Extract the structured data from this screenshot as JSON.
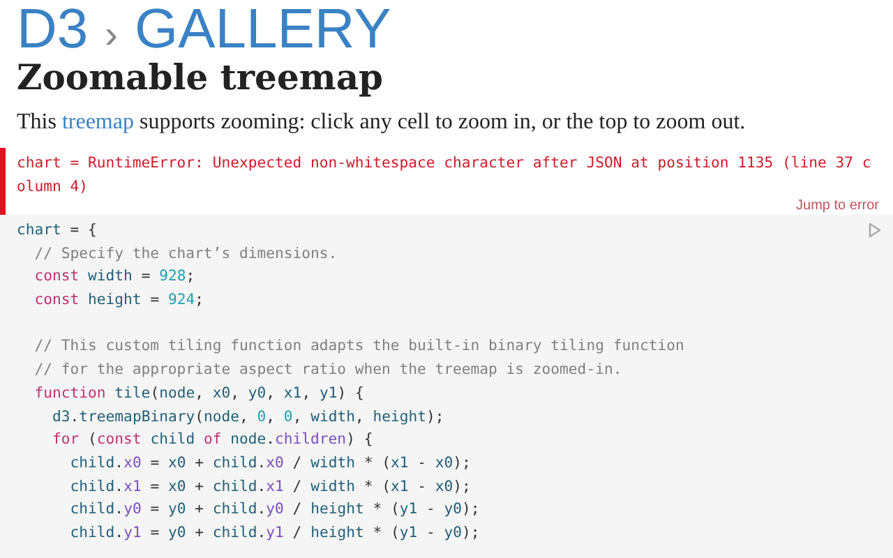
{
  "header": {
    "brand": "D3",
    "separator": "›",
    "section": "GALLERY"
  },
  "title": "Zoomable treemap",
  "intro": {
    "before": "This ",
    "link": "treemap",
    "after": " supports zooming: click any cell to zoom in, or the top to zoom out."
  },
  "error": {
    "message": "chart = RuntimeError: Unexpected non-whitespace character after JSON at position 1135 (line 37 column 4)",
    "button": "Jump to error"
  },
  "code": [
    {
      "kind": "code",
      "tokens": [
        {
          "kind": "v",
          "text": "chart "
        },
        {
          "kind": "p",
          "text": "= {"
        }
      ]
    },
    {
      "kind": "code",
      "tokens": [
        {
          "kind": "c",
          "text": "  // Specify the chart’s dimensions."
        }
      ]
    },
    {
      "kind": "code",
      "tokens": [
        {
          "kind": "k",
          "text": "  const "
        },
        {
          "kind": "v",
          "text": "width "
        },
        {
          "kind": "p",
          "text": "= "
        },
        {
          "kind": "n",
          "text": "928"
        },
        {
          "kind": "p",
          "text": ";"
        }
      ]
    },
    {
      "kind": "code",
      "tokens": [
        {
          "kind": "k",
          "text": "  const "
        },
        {
          "kind": "v",
          "text": "height "
        },
        {
          "kind": "p",
          "text": "= "
        },
        {
          "kind": "n",
          "text": "924"
        },
        {
          "kind": "p",
          "text": ";"
        }
      ]
    },
    {
      "kind": "blank"
    },
    {
      "kind": "code",
      "tokens": [
        {
          "kind": "c",
          "text": "  // This custom tiling function adapts the built-in binary tiling function"
        }
      ]
    },
    {
      "kind": "code",
      "tokens": [
        {
          "kind": "c",
          "text": "  // for the appropriate aspect ratio when the treemap is zoomed-in."
        }
      ]
    },
    {
      "kind": "code",
      "tokens": [
        {
          "kind": "k",
          "text": "  function "
        },
        {
          "kind": "v",
          "text": "tile"
        },
        {
          "kind": "p",
          "text": "("
        },
        {
          "kind": "v",
          "text": "node"
        },
        {
          "kind": "p",
          "text": ", "
        },
        {
          "kind": "v",
          "text": "x0"
        },
        {
          "kind": "p",
          "text": ", "
        },
        {
          "kind": "v",
          "text": "y0"
        },
        {
          "kind": "p",
          "text": ", "
        },
        {
          "kind": "v",
          "text": "x1"
        },
        {
          "kind": "p",
          "text": ", "
        },
        {
          "kind": "v",
          "text": "y1"
        },
        {
          "kind": "p",
          "text": ") {"
        }
      ]
    },
    {
      "kind": "code",
      "tokens": [
        {
          "kind": "v",
          "text": "    d3"
        },
        {
          "kind": "p",
          "text": "."
        },
        {
          "kind": "v",
          "text": "treemapBinary"
        },
        {
          "kind": "p",
          "text": "("
        },
        {
          "kind": "v",
          "text": "node"
        },
        {
          "kind": "p",
          "text": ", "
        },
        {
          "kind": "n",
          "text": "0"
        },
        {
          "kind": "p",
          "text": ", "
        },
        {
          "kind": "n",
          "text": "0"
        },
        {
          "kind": "p",
          "text": ", "
        },
        {
          "kind": "v",
          "text": "width"
        },
        {
          "kind": "p",
          "text": ", "
        },
        {
          "kind": "v",
          "text": "height"
        },
        {
          "kind": "p",
          "text": ");"
        }
      ]
    },
    {
      "kind": "code",
      "tokens": [
        {
          "kind": "k",
          "text": "    for "
        },
        {
          "kind": "p",
          "text": "("
        },
        {
          "kind": "k",
          "text": "const "
        },
        {
          "kind": "v",
          "text": "child "
        },
        {
          "kind": "k",
          "text": "of "
        },
        {
          "kind": "v",
          "text": "node"
        },
        {
          "kind": "p",
          "text": "."
        },
        {
          "kind": "m",
          "text": "children"
        },
        {
          "kind": "p",
          "text": ") {"
        }
      ]
    },
    {
      "kind": "code",
      "tokens": [
        {
          "kind": "v",
          "text": "      child"
        },
        {
          "kind": "p",
          "text": "."
        },
        {
          "kind": "m",
          "text": "x0 "
        },
        {
          "kind": "p",
          "text": "= "
        },
        {
          "kind": "v",
          "text": "x0 "
        },
        {
          "kind": "p",
          "text": "+ "
        },
        {
          "kind": "v",
          "text": "child"
        },
        {
          "kind": "p",
          "text": "."
        },
        {
          "kind": "m",
          "text": "x0 "
        },
        {
          "kind": "p",
          "text": "/ "
        },
        {
          "kind": "v",
          "text": "width "
        },
        {
          "kind": "p",
          "text": "* ("
        },
        {
          "kind": "v",
          "text": "x1 "
        },
        {
          "kind": "p",
          "text": "- "
        },
        {
          "kind": "v",
          "text": "x0"
        },
        {
          "kind": "p",
          "text": ");"
        }
      ]
    },
    {
      "kind": "code",
      "tokens": [
        {
          "kind": "v",
          "text": "      child"
        },
        {
          "kind": "p",
          "text": "."
        },
        {
          "kind": "m",
          "text": "x1 "
        },
        {
          "kind": "p",
          "text": "= "
        },
        {
          "kind": "v",
          "text": "x0 "
        },
        {
          "kind": "p",
          "text": "+ "
        },
        {
          "kind": "v",
          "text": "child"
        },
        {
          "kind": "p",
          "text": "."
        },
        {
          "kind": "m",
          "text": "x1 "
        },
        {
          "kind": "p",
          "text": "/ "
        },
        {
          "kind": "v",
          "text": "width "
        },
        {
          "kind": "p",
          "text": "* ("
        },
        {
          "kind": "v",
          "text": "x1 "
        },
        {
          "kind": "p",
          "text": "- "
        },
        {
          "kind": "v",
          "text": "x0"
        },
        {
          "kind": "p",
          "text": ");"
        }
      ]
    },
    {
      "kind": "code",
      "tokens": [
        {
          "kind": "v",
          "text": "      child"
        },
        {
          "kind": "p",
          "text": "."
        },
        {
          "kind": "m",
          "text": "y0 "
        },
        {
          "kind": "p",
          "text": "= "
        },
        {
          "kind": "v",
          "text": "y0 "
        },
        {
          "kind": "p",
          "text": "+ "
        },
        {
          "kind": "v",
          "text": "child"
        },
        {
          "kind": "p",
          "text": "."
        },
        {
          "kind": "m",
          "text": "y0 "
        },
        {
          "kind": "p",
          "text": "/ "
        },
        {
          "kind": "v",
          "text": "height "
        },
        {
          "kind": "p",
          "text": "* ("
        },
        {
          "kind": "v",
          "text": "y1 "
        },
        {
          "kind": "p",
          "text": "- "
        },
        {
          "kind": "v",
          "text": "y0"
        },
        {
          "kind": "p",
          "text": ");"
        }
      ]
    },
    {
      "kind": "code",
      "tokens": [
        {
          "kind": "v",
          "text": "      child"
        },
        {
          "kind": "p",
          "text": "."
        },
        {
          "kind": "m",
          "text": "y1 "
        },
        {
          "kind": "p",
          "text": "= "
        },
        {
          "kind": "v",
          "text": "y0 "
        },
        {
          "kind": "p",
          "text": "+ "
        },
        {
          "kind": "v",
          "text": "child"
        },
        {
          "kind": "p",
          "text": "."
        },
        {
          "kind": "m",
          "text": "y1 "
        },
        {
          "kind": "p",
          "text": "/ "
        },
        {
          "kind": "v",
          "text": "height "
        },
        {
          "kind": "p",
          "text": "* ("
        },
        {
          "kind": "v",
          "text": "y1 "
        },
        {
          "kind": "p",
          "text": "- "
        },
        {
          "kind": "v",
          "text": "y0"
        },
        {
          "kind": "p",
          "text": ");"
        }
      ]
    }
  ]
}
